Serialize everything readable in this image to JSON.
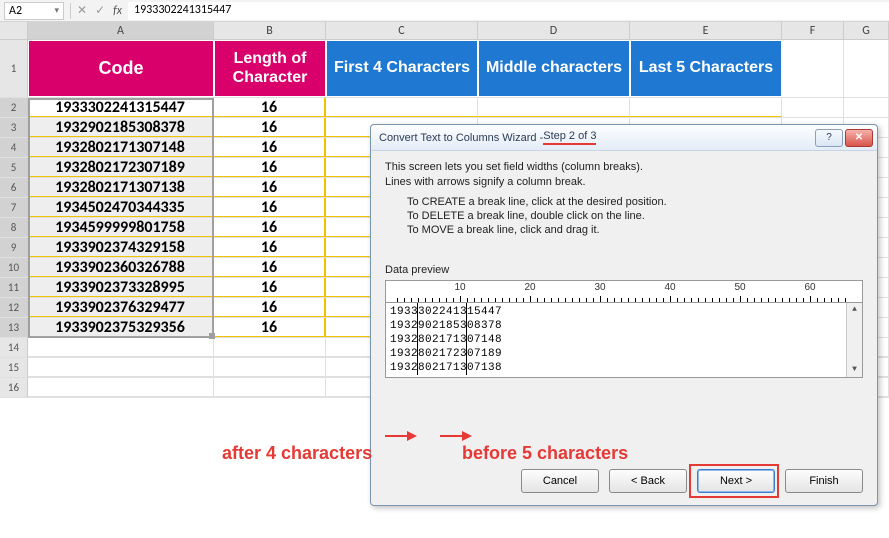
{
  "ref": {
    "name": "A2",
    "formula": "1933302241315447"
  },
  "columns": [
    "A",
    "B",
    "C",
    "D",
    "E",
    "F",
    "G"
  ],
  "headers": {
    "code": "Code",
    "length": "Length of Character",
    "first4": "First 4 Characters",
    "middle": "Middle characters",
    "last5": "Last 5 Characters"
  },
  "rows": [
    {
      "n": 2,
      "code": "1933302241315447",
      "len": "16"
    },
    {
      "n": 3,
      "code": "1932902185308378",
      "len": "16"
    },
    {
      "n": 4,
      "code": "1932802171307148",
      "len": "16"
    },
    {
      "n": 5,
      "code": "1932802172307189",
      "len": "16"
    },
    {
      "n": 6,
      "code": "1932802171307138",
      "len": "16"
    },
    {
      "n": 7,
      "code": "1934502470344335",
      "len": "16"
    },
    {
      "n": 8,
      "code": "1934599999801758",
      "len": "16"
    },
    {
      "n": 9,
      "code": "1933902374329158",
      "len": "16"
    },
    {
      "n": 10,
      "code": "1933902360326788",
      "len": "16"
    },
    {
      "n": 11,
      "code": "1933902373328995",
      "len": "16"
    },
    {
      "n": 12,
      "code": "1933902376329477",
      "len": "16"
    },
    {
      "n": 13,
      "code": "1933902375329356",
      "len": "16"
    }
  ],
  "emptyRows": [
    14,
    15,
    16
  ],
  "dialog": {
    "title_prefix": "Convert Text to Columns Wizard - ",
    "title_step": "Step 2 of 3",
    "line1": "This screen lets you set field widths (column breaks).",
    "line2": "Lines with arrows signify a column break.",
    "instr1": "To CREATE a break line, click at the desired position.",
    "instr2": "To DELETE a break line, double click on the line.",
    "instr3": "To MOVE a break line, click and drag it.",
    "preview_label": "Data preview",
    "ruler_ticks": [
      "10",
      "20",
      "30",
      "40",
      "50",
      "60"
    ],
    "preview_lines": [
      "1933302241315447",
      "1932902185308378",
      "1932802171307148",
      "1932802172307189",
      "1932802171307138"
    ],
    "buttons": {
      "cancel": "Cancel",
      "back": "< Back",
      "next": "Next >",
      "finish": "Finish"
    },
    "help_icon": "?",
    "close_icon": "✕"
  },
  "annotations": {
    "after": "after 4 characters",
    "before": "before 5 characters"
  }
}
